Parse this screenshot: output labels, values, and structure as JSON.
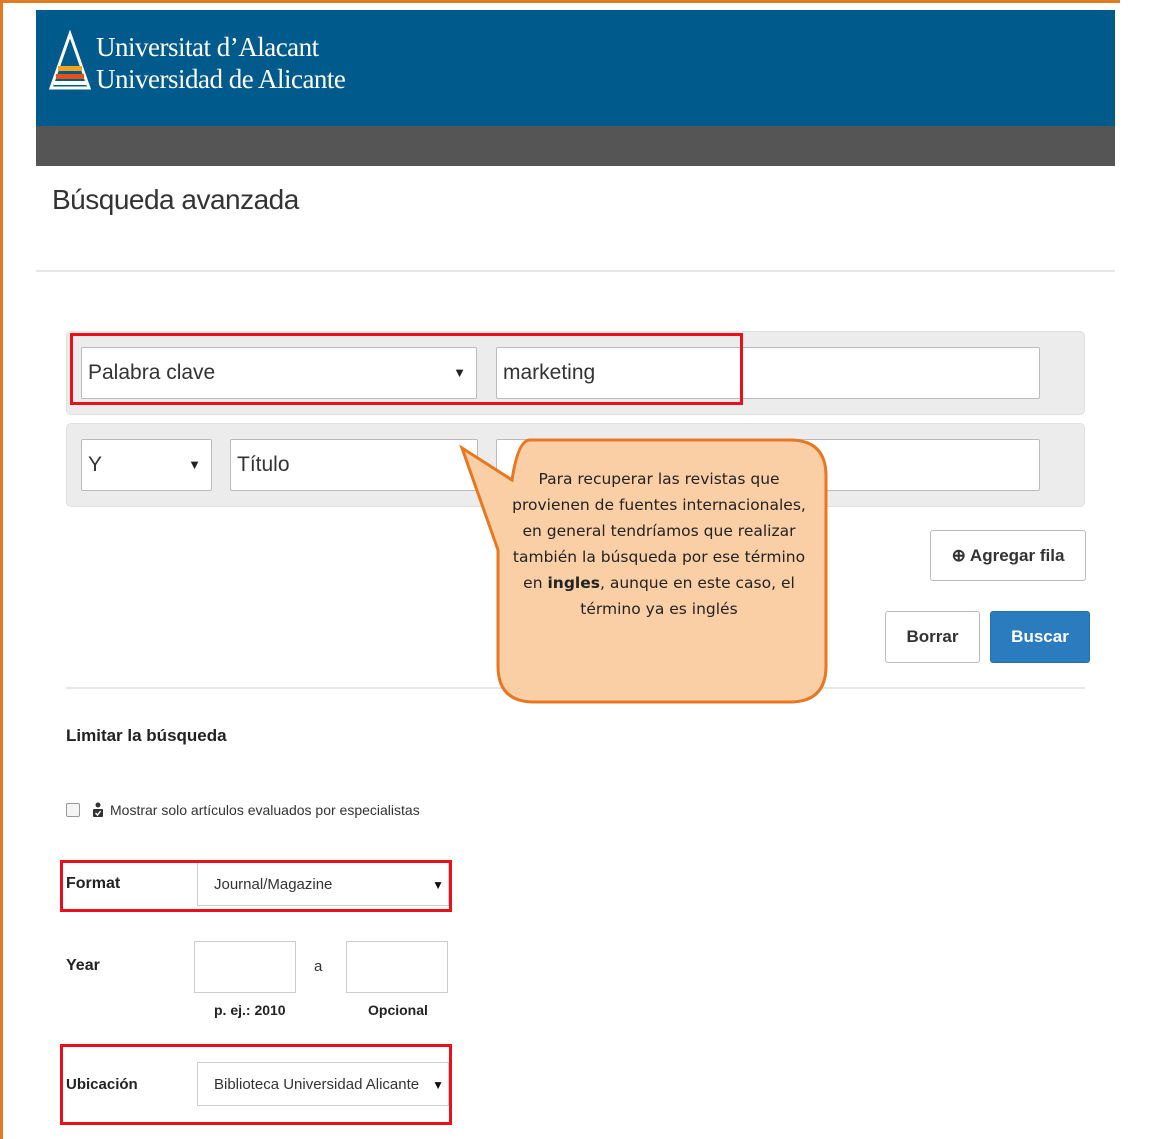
{
  "header": {
    "brand_line1": "Universitat d’Alacant",
    "brand_line2": "Universidad de Alicante"
  },
  "page_title": "Búsqueda avanzada",
  "search_rows": [
    {
      "field": "Palabra clave",
      "value": "marketing"
    },
    {
      "operator": "Y",
      "field": "Título",
      "value": ""
    }
  ],
  "buttons": {
    "add_row": "Agregar fila",
    "clear": "Borrar",
    "search": "Buscar"
  },
  "callout": {
    "text_before": "Para recuperar  las revistas que provienen de fuentes internacionales, en general tendríamos que realizar también la búsqueda por ese término  en ",
    "bold": "ingles",
    "text_after": ", aunque en este caso, el término  ya es inglés"
  },
  "limits": {
    "heading": "Limitar la búsqueda",
    "peer_reviewed_label": "Mostrar solo artículos evaluados por especialistas",
    "peer_reviewed_checked": false,
    "format_label": "Format",
    "format_value": "Journal/Magazine",
    "year_label": "Year",
    "year_separator": "a",
    "year_from_hint": "p. ej.: 2010",
    "year_to_hint": "Opcional",
    "location_label": "Ubicación",
    "location_value": "Biblioteca Universidad Alicante"
  },
  "colors": {
    "header_blue": "#005a8c",
    "navbar_gray": "#555555",
    "highlight_red": "#e8101a",
    "callout_fill": "#fbcfa6",
    "callout_border": "#e87722",
    "primary_button": "#2b7bbf"
  },
  "icons": [
    "university-logo-icon",
    "dropdown-arrow-icon",
    "plus-circle-icon",
    "peer-review-icon"
  ]
}
